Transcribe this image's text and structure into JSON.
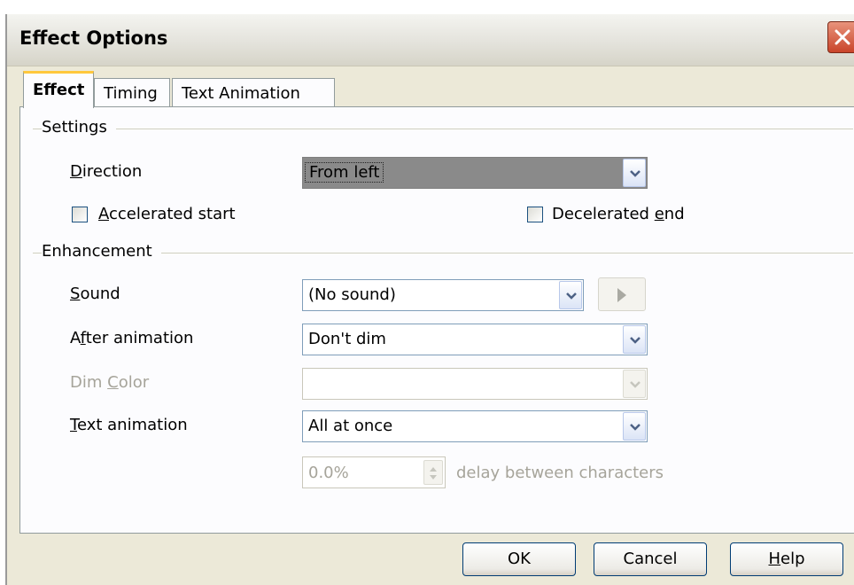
{
  "window": {
    "title": "Effect Options"
  },
  "tabs": [
    {
      "label": "Effect",
      "active": true
    },
    {
      "label": "Timing",
      "active": false
    },
    {
      "label": "Text Animation",
      "active": false
    }
  ],
  "settings": {
    "section_label": "Settings",
    "direction": {
      "label_u": "D",
      "label_rest": "irection",
      "value": "From left"
    },
    "accelerated_start": {
      "label_u": "A",
      "label_rest": "ccelerated start",
      "checked": false
    },
    "decelerated_end": {
      "label_pre": "Decelerated ",
      "label_u": "e",
      "label_rest": "nd",
      "checked": false
    }
  },
  "enhancement": {
    "section_label": "Enhancement",
    "sound": {
      "label_u": "S",
      "label_rest": "ound",
      "value": "(No sound)"
    },
    "after_animation": {
      "label_pre": "A",
      "label_u": "f",
      "label_rest": "ter animation",
      "value": "Don't dim"
    },
    "dim_color": {
      "label_pre": "Dim ",
      "label_u": "C",
      "label_rest": "olor",
      "value": "",
      "enabled": false
    },
    "text_animation": {
      "label_u": "T",
      "label_rest": "ext animation",
      "value": "All at once"
    },
    "delay": {
      "value": "0.0%",
      "suffix": "delay between characters",
      "enabled": false
    }
  },
  "buttons": {
    "ok": "OK",
    "cancel": "Cancel",
    "help_u": "H",
    "help_rest": "elp"
  },
  "icons": {
    "close": "close-icon",
    "dropdown": "chevron-down-icon",
    "play": "play-icon",
    "spin": "spin-updown-icon"
  }
}
